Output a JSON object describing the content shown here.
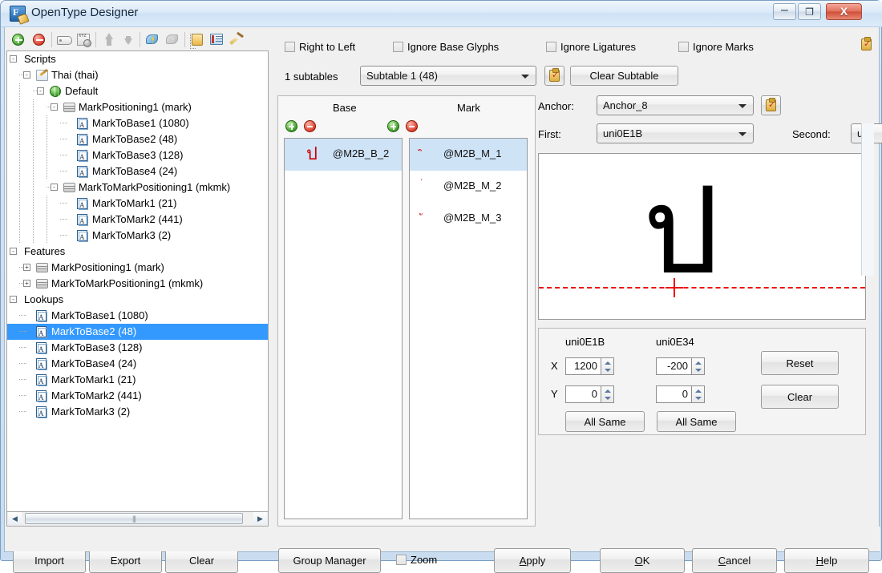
{
  "window": {
    "title": "OpenType Designer",
    "app_icon": "font-designer-icon",
    "minimize": "–",
    "maximize": "❐",
    "close": "X"
  },
  "toolbar": {
    "buttons": [
      {
        "name": "add-icon",
        "glyph": ""
      },
      {
        "name": "remove-icon",
        "glyph": ""
      },
      {
        "name": "tag-icon",
        "glyph": ""
      },
      {
        "name": "xyz-glyph-icon",
        "glyph": ""
      },
      {
        "name": "move-up-icon",
        "glyph": ""
      },
      {
        "name": "move-down-icon",
        "glyph": ""
      },
      {
        "name": "lightning-icon",
        "glyph": ""
      },
      {
        "name": "lightning-disabled-icon",
        "glyph": ""
      },
      {
        "name": "list-icon",
        "glyph": ""
      },
      {
        "name": "form-icon",
        "glyph": ""
      },
      {
        "name": "broom-icon",
        "glyph": ""
      }
    ]
  },
  "tree": {
    "nodes": [
      {
        "label": "Scripts",
        "depth": 0,
        "expander": "-",
        "icon": "none",
        "selected": false
      },
      {
        "label": "Thai (thai)",
        "depth": 1,
        "expander": "-",
        "icon": "pencil",
        "selected": false
      },
      {
        "label": "Default",
        "depth": 2,
        "expander": "-",
        "icon": "globe",
        "selected": false
      },
      {
        "label": "MarkPositioning1 (mark)",
        "depth": 3,
        "expander": "-",
        "icon": "box",
        "selected": false
      },
      {
        "label": "MarkToBase1 (1080)",
        "depth": 4,
        "expander": "",
        "icon": "lookup",
        "selected": false
      },
      {
        "label": "MarkToBase2 (48)",
        "depth": 4,
        "expander": "",
        "icon": "lookup",
        "selected": false
      },
      {
        "label": "MarkToBase3 (128)",
        "depth": 4,
        "expander": "",
        "icon": "lookup",
        "selected": false
      },
      {
        "label": "MarkToBase4 (24)",
        "depth": 4,
        "expander": "",
        "icon": "lookup",
        "selected": false
      },
      {
        "label": "MarkToMarkPositioning1 (mkmk)",
        "depth": 3,
        "expander": "-",
        "icon": "box",
        "selected": false
      },
      {
        "label": "MarkToMark1 (21)",
        "depth": 4,
        "expander": "",
        "icon": "lookup",
        "selected": false
      },
      {
        "label": "MarkToMark2 (441)",
        "depth": 4,
        "expander": "",
        "icon": "lookup",
        "selected": false
      },
      {
        "label": "MarkToMark3 (2)",
        "depth": 4,
        "expander": "",
        "icon": "lookup",
        "selected": false
      },
      {
        "label": "Features",
        "depth": 0,
        "expander": "-",
        "icon": "none",
        "selected": false
      },
      {
        "label": "MarkPositioning1 (mark)",
        "depth": 1,
        "expander": "+",
        "icon": "box",
        "selected": false
      },
      {
        "label": "MarkToMarkPositioning1 (mkmk)",
        "depth": 1,
        "expander": "+",
        "icon": "box",
        "selected": false
      },
      {
        "label": "Lookups",
        "depth": 0,
        "expander": "-",
        "icon": "none",
        "selected": false
      },
      {
        "label": "MarkToBase1 (1080)",
        "depth": 1,
        "expander": "",
        "icon": "lookup",
        "selected": false
      },
      {
        "label": "MarkToBase2 (48)",
        "depth": 1,
        "expander": "",
        "icon": "lookup",
        "selected": true
      },
      {
        "label": "MarkToBase3 (128)",
        "depth": 1,
        "expander": "",
        "icon": "lookup",
        "selected": false
      },
      {
        "label": "MarkToBase4 (24)",
        "depth": 1,
        "expander": "",
        "icon": "lookup",
        "selected": false
      },
      {
        "label": "MarkToMark1 (21)",
        "depth": 1,
        "expander": "",
        "icon": "lookup",
        "selected": false
      },
      {
        "label": "MarkToMark2 (441)",
        "depth": 1,
        "expander": "",
        "icon": "lookup",
        "selected": false
      },
      {
        "label": "MarkToMark3 (2)",
        "depth": 1,
        "expander": "",
        "icon": "lookup",
        "selected": false
      }
    ]
  },
  "left_buttons": {
    "import": "Import",
    "export": "Export",
    "clear": "Clear"
  },
  "flags": {
    "right_to_left": {
      "label": "Right to Left",
      "checked": false
    },
    "ignore_base_glyphs": {
      "label": "Ignore Base Glyphs",
      "checked": false
    },
    "ignore_ligatures": {
      "label": "Ignore Ligatures",
      "checked": false
    },
    "ignore_marks": {
      "label": "Ignore Marks",
      "checked": false
    }
  },
  "subtable": {
    "count_label": "1 subtables",
    "selected": "Subtable 1 (48)",
    "clear_button": "Clear Subtable",
    "copy_icon": "clipboard-check-icon"
  },
  "lists": {
    "base_header": "Base",
    "mark_header": "Mark",
    "base_items": [
      {
        "name": "@M2B_B_2",
        "preview": "ป",
        "selected": true
      }
    ],
    "mark_items": [
      {
        "name": "@M2B_M_1",
        "preview": "ิ",
        "selected": true
      },
      {
        "name": "@M2B_M_2",
        "preview": "่",
        "selected": false
      },
      {
        "name": "@M2B_M_3",
        "preview": "ั",
        "selected": false
      }
    ],
    "add_base_icon": "add-base-icon",
    "remove_base_icon": "remove-base-icon",
    "add_mark_icon": "add-mark-icon",
    "remove_mark_icon": "remove-mark-icon"
  },
  "anchor": {
    "anchor_label": "Anchor:",
    "anchor_value": "Anchor_8",
    "first_label": "First:",
    "first_value": "uni0E1B",
    "second_label": "Second:",
    "second_value": "u",
    "copy_icon": "clipboard-check-icon"
  },
  "preview": {
    "glyph": "ป",
    "baseline_color": "#ee0000",
    "anchor_marker": "crosshair-icon"
  },
  "coords": {
    "first_glyph": "uni0E1B",
    "second_glyph": "uni0E34",
    "x_label": "X",
    "y_label": "Y",
    "first_x": "1200",
    "first_y": "0",
    "second_x": "-200",
    "second_y": "0",
    "all_same_first": "All Same",
    "all_same_second": "All Same",
    "reset": "Reset",
    "clear": "Clear"
  },
  "bottom": {
    "group_manager": "Group Manager",
    "zoom_label": "Zoom",
    "zoom_checked": false,
    "apply": "Apply",
    "apply_mnemonic": "A",
    "ok": "OK",
    "ok_mnemonic": "O",
    "cancel": "Cancel",
    "cancel_mnemonic": "C",
    "help": "Help",
    "help_mnemonic": "H"
  },
  "colors": {
    "selection": "#3399ff",
    "list_selection": "#cfe3f7",
    "accent_red": "#cc0000",
    "window_bg": "#f0f0f0"
  }
}
